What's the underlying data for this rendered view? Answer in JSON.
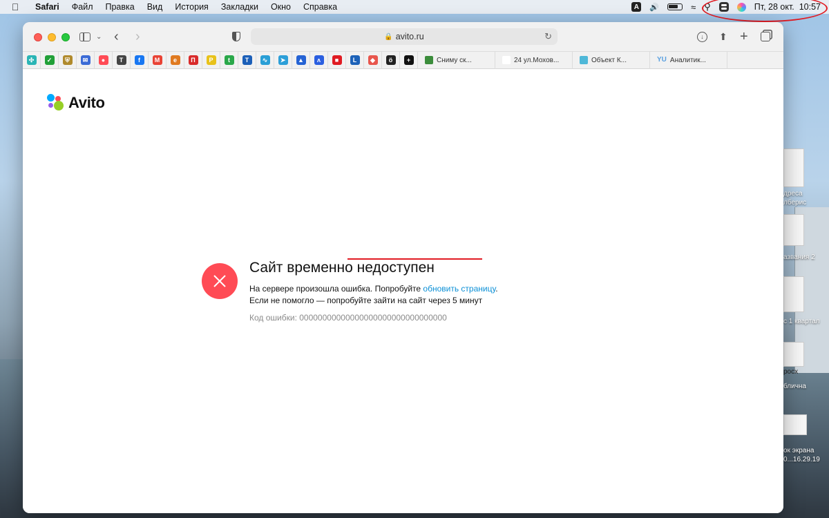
{
  "menubar": {
    "items": [
      "Safari",
      "Файл",
      "Правка",
      "Вид",
      "История",
      "Закладки",
      "Окно",
      "Справка"
    ],
    "input_indicator": "A",
    "datetime": "Пт, 28 окт.  10:57"
  },
  "browser": {
    "url": "avito.ru",
    "favorites": [
      {
        "icon": "grid-icon",
        "color": "#2bb5b5",
        "glyph": "✣"
      },
      {
        "icon": "sber-icon",
        "color": "#21a038",
        "glyph": "✓"
      },
      {
        "icon": "shield-emblem-icon",
        "color": "#b08a2c",
        "glyph": "⛨"
      },
      {
        "icon": "mail-icon",
        "color": "#3b6bd6",
        "glyph": "✉"
      },
      {
        "icon": "avito-dots-icon",
        "color": "#ff4b55",
        "glyph": "●"
      },
      {
        "icon": "t-circle-icon",
        "color": "#444444",
        "glyph": "T"
      },
      {
        "icon": "facebook-icon",
        "color": "#1877f2",
        "glyph": "f"
      },
      {
        "icon": "gmail-icon",
        "color": "#e94335",
        "glyph": "M"
      },
      {
        "icon": "esbn-icon",
        "color": "#e07a20",
        "glyph": "e"
      },
      {
        "icon": "red-gate-icon",
        "color": "#d92b2b",
        "glyph": "П"
      },
      {
        "icon": "pro-icon",
        "color": "#e8c21a",
        "glyph": "P"
      },
      {
        "icon": "green-t-icon",
        "color": "#2aa84a",
        "glyph": "t"
      },
      {
        "icon": "blue-t-icon",
        "color": "#1b5fb8",
        "glyph": "T"
      },
      {
        "icon": "pulse-icon",
        "color": "#2a9fd6",
        "glyph": "∿"
      },
      {
        "icon": "telegram-icon",
        "color": "#2d9fd8",
        "glyph": "➤"
      },
      {
        "icon": "atlassian-icon",
        "color": "#2563d4",
        "glyph": "▲"
      },
      {
        "icon": "chevron-logo-icon",
        "color": "#2b5fe0",
        "glyph": "ʌ"
      },
      {
        "icon": "red-square-icon",
        "color": "#e01b22",
        "glyph": "■"
      },
      {
        "icon": "l-icon",
        "color": "#1d62b8",
        "glyph": "L"
      },
      {
        "icon": "cube-icon",
        "color": "#e8564d",
        "glyph": "◆"
      },
      {
        "icon": "o-umlaut-icon",
        "color": "#222222",
        "glyph": "ö"
      },
      {
        "icon": "plus-circle-icon",
        "color": "#111111",
        "glyph": "+"
      }
    ],
    "bookmark_tabs": [
      {
        "label": "Сниму ск...",
        "color": "#3c8d3c"
      },
      {
        "label": "24  ул.Мохов...",
        "color": "#ffffff"
      },
      {
        "label": "Объект К...",
        "color": "#4fb8d8"
      },
      {
        "label": "Аналитик...",
        "color": "#5aa0e0",
        "prefix": "YU"
      }
    ]
  },
  "page": {
    "logo": "Avito",
    "error": {
      "title": "Сайт временно недоступен",
      "line1_prefix": "На сервере произошла ошибка. Попробуйте ",
      "line1_link": "обновить страницу",
      "line1_suffix": ".",
      "line2": "Если не помогло — попробуйте зайти на сайт через 5 минут",
      "code": "Код ошибки: 00000000000000000000000000000000"
    }
  },
  "desktop": {
    "labels": [
      "дреса",
      "лберис",
      "азвания 2",
      "с 1 квартал",
      "росх",
      "блична",
      "ок экрана",
      "0...16.29.19"
    ]
  },
  "colors": {
    "avito_red": "#ff4b55",
    "link_blue": "#0a8fd6",
    "annotation_red": "#e11b22"
  }
}
